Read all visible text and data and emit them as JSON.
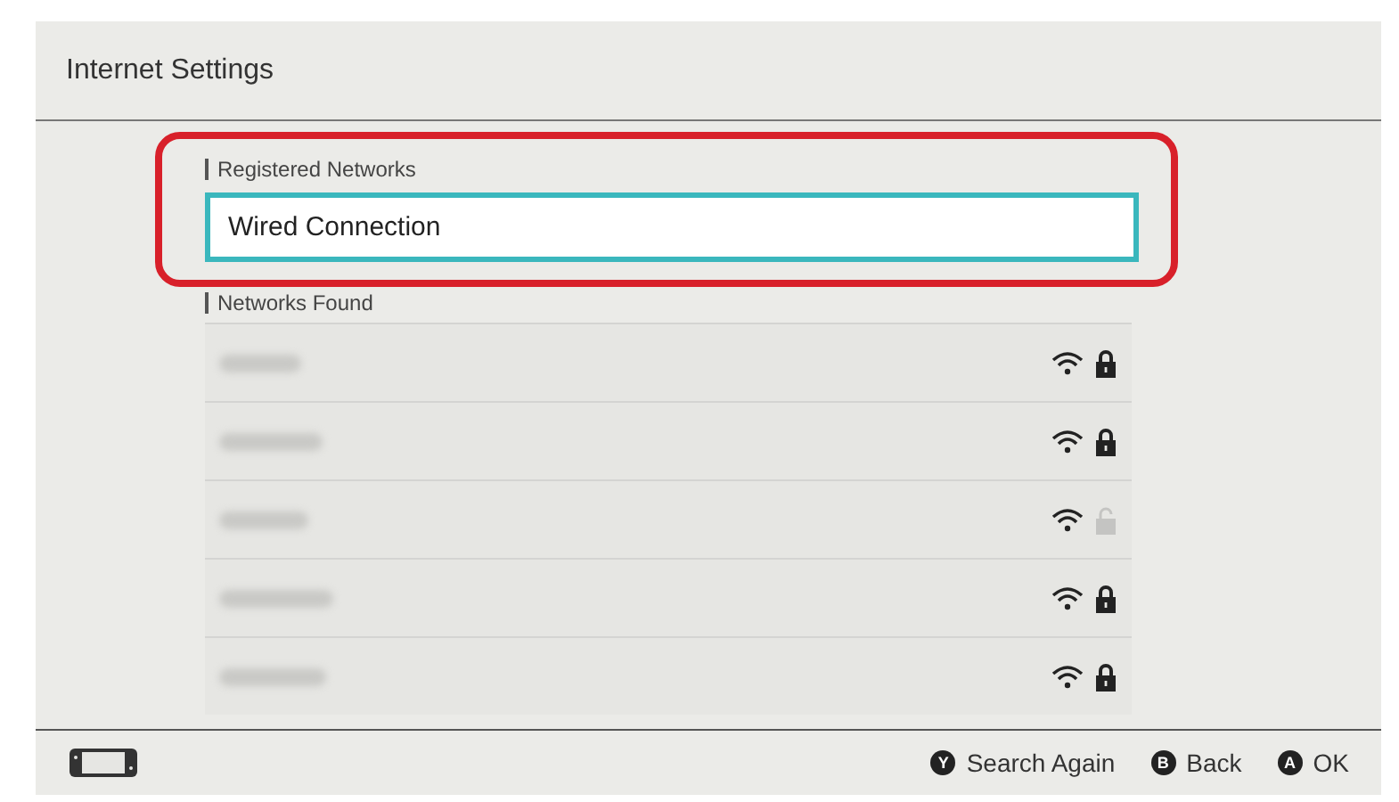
{
  "header": {
    "title": "Internet Settings"
  },
  "registered": {
    "heading": "Registered Networks",
    "highlighted": true,
    "items": [
      {
        "label": "Wired Connection",
        "selected": true
      }
    ]
  },
  "found": {
    "heading": "Networks Found",
    "networks": [
      {
        "locked": true
      },
      {
        "locked": true
      },
      {
        "locked": false
      },
      {
        "locked": true
      },
      {
        "locked": true
      }
    ]
  },
  "footer": {
    "actions": [
      {
        "key": "Y",
        "label": "Search Again"
      },
      {
        "key": "B",
        "label": "Back"
      },
      {
        "key": "A",
        "label": "OK"
      }
    ]
  }
}
